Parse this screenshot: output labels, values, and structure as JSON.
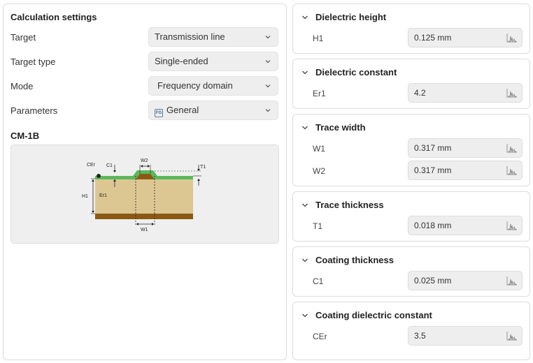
{
  "calculation_settings": {
    "title": "Calculation settings",
    "rows": [
      {
        "label": "Target",
        "value": "Transmission line"
      },
      {
        "label": "Target type",
        "value": "Single-ended"
      },
      {
        "label": "Mode",
        "value": "Frequency domain"
      },
      {
        "label": "Parameters",
        "value": "General",
        "badge": "FG"
      }
    ]
  },
  "model": {
    "name": "CM-1B",
    "diagram_labels": {
      "cer": "CEr",
      "c1": "C1",
      "w2": "W2",
      "t1": "T1",
      "h1": "H1",
      "er1": "Er1",
      "w1": "W1"
    },
    "colors": {
      "dielectric": "#dcc793",
      "ground": "#8a5a14",
      "trace": "#8a5a14",
      "coating": "#5cb85c"
    }
  },
  "cards": [
    {
      "title": "Dielectric height",
      "params": [
        {
          "label": "H1",
          "value": "0.125 mm"
        }
      ]
    },
    {
      "title": "Dielectric constant",
      "params": [
        {
          "label": "Er1",
          "value": "4.2"
        }
      ]
    },
    {
      "title": "Trace width",
      "params": [
        {
          "label": "W1",
          "value": "0.317 mm"
        },
        {
          "label": "W2",
          "value": "0.317 mm"
        }
      ]
    },
    {
      "title": "Trace thickness",
      "params": [
        {
          "label": "T1",
          "value": "0.018 mm"
        }
      ]
    },
    {
      "title": "Coating thickness",
      "params": [
        {
          "label": "C1",
          "value": "0.025 mm"
        }
      ]
    },
    {
      "title": "Coating dielectric constant",
      "params": [
        {
          "label": "CEr",
          "value": "3.5"
        }
      ]
    }
  ],
  "icons": {
    "collapse": "chevron-down-icon",
    "dropdown": "chevron-down-icon",
    "sweep": "sweep-chart-icon",
    "badge": "fg-badge-icon"
  }
}
